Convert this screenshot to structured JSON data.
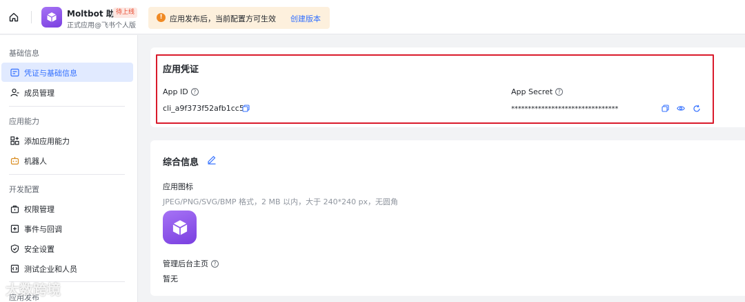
{
  "header": {
    "app_name": "Moltbot 助手",
    "status_badge": "待上线",
    "app_subtitle": "正式应用@飞书个人版",
    "notice_text": "应用发布后，当前配置方可生效",
    "notice_link": "创建版本"
  },
  "sidebar": {
    "groups": [
      {
        "title": "基础信息",
        "items": [
          {
            "label": "凭证与基础信息",
            "icon": "credential-icon",
            "active": true
          },
          {
            "label": "成员管理",
            "icon": "member-icon"
          }
        ]
      },
      {
        "title": "应用能力",
        "items": [
          {
            "label": "添加应用能力",
            "icon": "add-capability-icon"
          },
          {
            "label": "机器人",
            "icon": "robot-icon"
          }
        ]
      },
      {
        "title": "开发配置",
        "items": [
          {
            "label": "权限管理",
            "icon": "permission-icon"
          },
          {
            "label": "事件与回调",
            "icon": "event-icon"
          },
          {
            "label": "安全设置",
            "icon": "shield-icon"
          },
          {
            "label": "测试企业和人员",
            "icon": "test-icon"
          }
        ]
      },
      {
        "title": "应用发布",
        "items": []
      }
    ]
  },
  "credentials": {
    "title": "应用凭证",
    "app_id_label": "App ID",
    "app_id_value": "cli_a9f373f52afb1cc5",
    "app_secret_label": "App Secret",
    "app_secret_value": "********************************"
  },
  "general": {
    "title": "综合信息",
    "icon_label": "应用图标",
    "icon_hint": "JPEG/PNG/SVG/BMP 格式，2 MB 以内，大于 240*240 px，无圆角",
    "homepage_label": "管理后台主页",
    "homepage_value": "暂无"
  },
  "watermark": "大数跨境",
  "colors": {
    "accent": "#3370ff",
    "highlight_border": "#d9192a",
    "app_icon": "#8b55ea",
    "badge": "#e84a2f"
  }
}
